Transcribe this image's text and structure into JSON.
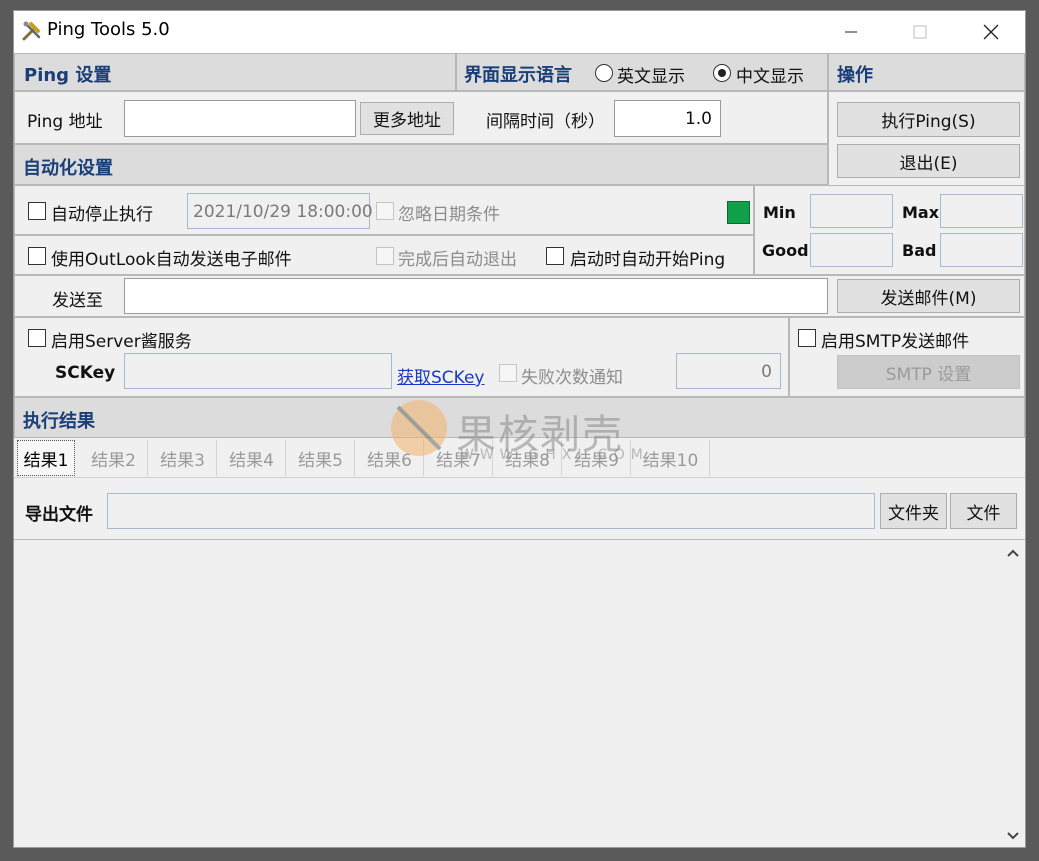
{
  "window": {
    "title": "Ping Tools 5.0"
  },
  "ping_settings": {
    "header": "Ping 设置",
    "address_label": "Ping 地址",
    "address_value": "",
    "more_addresses_button": "更多地址",
    "interval_label": "间隔时间（秒）",
    "interval_value": "1.0"
  },
  "language": {
    "header": "界面显示语言",
    "options": [
      {
        "label": "英文显示",
        "selected": false
      },
      {
        "label": "中文显示",
        "selected": true
      }
    ]
  },
  "operations": {
    "header": "操作",
    "run_button": "执行Ping(S)",
    "exit_button": "退出(E)"
  },
  "automation": {
    "header": "自动化设置",
    "auto_stop_label": "自动停止执行",
    "stop_datetime": "2021/10/29 18:00:00",
    "ignore_date_label": "忽略日期条件",
    "outlook_email_label": "使用OutLook自动发送电子邮件",
    "auto_exit_label": "完成后自动退出",
    "auto_start_label": "启动时自动开始Ping",
    "status_color": "#12a14b",
    "send_to_label": "发送至",
    "send_to_value": "",
    "send_mail_button": "发送邮件(M)"
  },
  "stats": {
    "min_label": "Min",
    "min_value": "",
    "max_label": "Max",
    "max_value": "",
    "good_label": "Good",
    "good_value": "",
    "bad_label": "Bad",
    "bad_value": ""
  },
  "server_chan": {
    "enable_label": "启用Server酱服务",
    "sckey_label": "SCKey",
    "sckey_value": "",
    "get_sckey_link": "获取SCKey",
    "fail_notify_label": "失败次数通知",
    "fail_count": "0"
  },
  "smtp": {
    "enable_label": "启用SMTP发送邮件",
    "settings_button": "SMTP 设置"
  },
  "results": {
    "header": "执行结果",
    "tabs": [
      "结果1",
      "结果2",
      "结果3",
      "结果4",
      "结果5",
      "结果6",
      "结果7",
      "结果8",
      "结果9",
      "结果10"
    ],
    "export_label": "导出文件",
    "export_path": "",
    "folder_button": "文件夹",
    "file_button": "文件"
  },
  "watermark": {
    "text": "果核剥壳",
    "url": "WWW.GHXI.COM"
  },
  "colors": {
    "header_text": "#1a3e78",
    "link": "#1a37c8",
    "accent_green": "#12a14b"
  }
}
